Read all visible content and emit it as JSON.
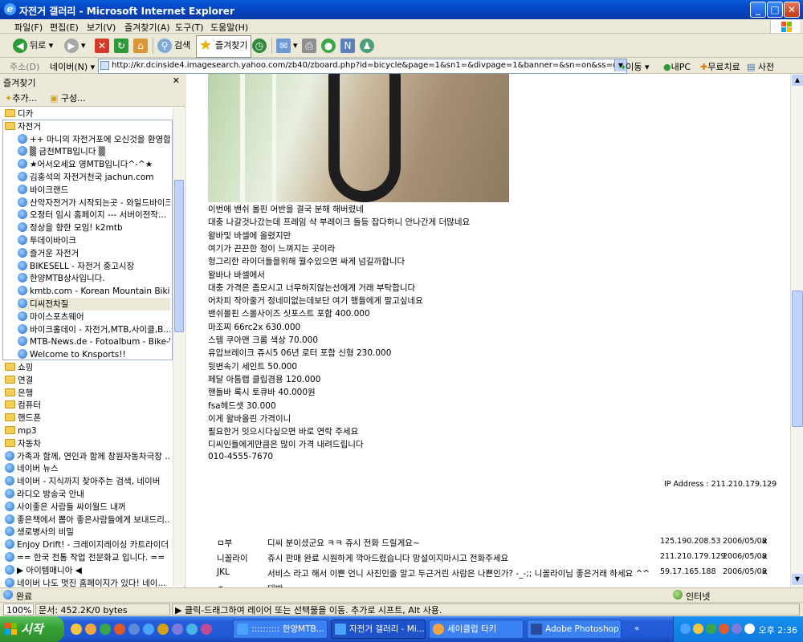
{
  "window": {
    "title": "자전거 갤러리 - Microsoft Internet Explorer",
    "minimize": "_",
    "maximize": "□",
    "close": "✕"
  },
  "menu": [
    "파일(F)",
    "편집(E)",
    "보기(V)",
    "즐겨찾기(A)",
    "도구(T)",
    "도움말(H)"
  ],
  "toolbar": {
    "back": "뒤로",
    "search": "검색",
    "favorites": "즐겨찾기"
  },
  "address": {
    "label": "주소(D)",
    "naver": "네이버(N)",
    "url": "http://kr.dcinside4.imagesearch.yahoo.com/zb40/zboard.php?id=bicycle&page=1&sn1=&divpage=1&banner=&sn=on&ss=off&sc=off&keyword",
    "go": "이동",
    "link1": "내PC",
    "link2": "무료치료",
    "link3": "사전"
  },
  "favorites": {
    "header": "즐겨찾기",
    "add": "추가...",
    "organize": "구성...",
    "items": [
      {
        "type": "folder",
        "label": "디카",
        "indent": 0
      },
      {
        "type": "folder",
        "label": "자전거",
        "indent": 0
      },
      {
        "type": "link",
        "label": "++ 마니의 자전거포에 오신것을 환영합...",
        "indent": 1
      },
      {
        "type": "link",
        "label": "▒ 금천MTB입니다 ▒",
        "indent": 1
      },
      {
        "type": "link",
        "label": "★어서오세요 영MTB입니다^-^★",
        "indent": 1
      },
      {
        "type": "link",
        "label": "김홍석의 자전거천국 jachun.com",
        "indent": 1
      },
      {
        "type": "link",
        "label": "바이크랜드",
        "indent": 1
      },
      {
        "type": "link",
        "label": "산악자전거가 시작되는곳 - 와일드바이크",
        "indent": 1
      },
      {
        "type": "link",
        "label": "오정터 임시 홈페이지 --- 서버이전작...",
        "indent": 1
      },
      {
        "type": "link",
        "label": "정상을 향한 모임! k2mtb",
        "indent": 1
      },
      {
        "type": "link",
        "label": "투데이바이크",
        "indent": 1
      },
      {
        "type": "link",
        "label": "즐거운 자전거",
        "indent": 1
      },
      {
        "type": "link",
        "label": "BIKESELL - 자전거 중고시장",
        "indent": 1
      },
      {
        "type": "link",
        "label": "한양MTB상사입니다.",
        "indent": 1
      },
      {
        "type": "link",
        "label": "kmtb.com - Korean Mountain Biking",
        "indent": 1
      },
      {
        "type": "link",
        "label": "디씨전차질",
        "indent": 1,
        "selected": true
      },
      {
        "type": "link",
        "label": "마이스포츠웨어",
        "indent": 1
      },
      {
        "type": "link",
        "label": "바이크홀데이 - 자전거,MTB,사이클,B...",
        "indent": 1
      },
      {
        "type": "link",
        "label": "MTB-News.de - Fotoalbum - Bike-W...",
        "indent": 1
      },
      {
        "type": "link",
        "label": "Welcome to Knsports!!",
        "indent": 1
      },
      {
        "type": "folder",
        "label": "쇼핑",
        "indent": 0
      },
      {
        "type": "folder",
        "label": "연결",
        "indent": 0
      },
      {
        "type": "folder",
        "label": "은행",
        "indent": 0
      },
      {
        "type": "folder",
        "label": "컴퓨터",
        "indent": 0
      },
      {
        "type": "folder",
        "label": "핸드폰",
        "indent": 0
      },
      {
        "type": "folder",
        "label": "mp3",
        "indent": 0
      },
      {
        "type": "folder",
        "label": "자동차",
        "indent": 0
      },
      {
        "type": "link",
        "label": "가족과 함께, 연인과 함께 창원자동차극장 ...",
        "indent": 0
      },
      {
        "type": "link",
        "label": "네이버  뉴스",
        "indent": 0
      },
      {
        "type": "link",
        "label": "네이버 - 지식까지 찾아주는 검색, 네이버",
        "indent": 0
      },
      {
        "type": "link",
        "label": "라디오 방송국 안내",
        "indent": 0
      },
      {
        "type": "link",
        "label": "사이좋은 사람들 싸이월드 내꺼",
        "indent": 0
      },
      {
        "type": "link",
        "label": "좋은책에서 뽑아 좋은사람들에게 보내드리...",
        "indent": 0
      },
      {
        "type": "link",
        "label": "생로병사의 비밀",
        "indent": 0
      },
      {
        "type": "link",
        "label": "Enjoy Drift! - 크레이지레이싱 카트라이더",
        "indent": 0
      },
      {
        "type": "link",
        "label": "== 한국 전통 작업 전문화교 입니다. ==",
        "indent": 0
      },
      {
        "type": "link",
        "label": "▶ 아이템매니아 ◀",
        "indent": 0
      },
      {
        "type": "link",
        "label": "네이버  나도 멋진 홈페이지가 있다! 네이...",
        "indent": 0
      }
    ]
  },
  "post": {
    "lines": [
      "이번에 밴쉬 몰핀 어반을 결국 분해 해버렸네",
      "대충 나갈것나갔는데 프레임 샥 부레이크 들등 잡다하니 안나간게 더많네요",
      "왈바및 바셀에 올렸지만",
      "여기가 끈끈한 정이 느껴지는 곳이라",
      "헝그리한 라이더들을위해 뭘수있으면 싸게 넘길까합니다",
      "왈바나 바셀에서",
      "대충 가격은 좀모시고 너무하지않는선에게 거래 부탁합니다",
      "어차피 작아줄거 정네미없는데보단 여기 행들에게 팔고싶네요",
      "밴쉬몰핀 스몰사이즈 싯포스트 포함 400.000",
      "마조찌 66rc2x 630.000",
      "스템 쿠아맨 크롬 색상 70.000",
      "유압브레이크 쥬시5 06년 로터 포함 신형 230.000",
      "뒷변속기 세인트 50.000",
      "페달 아톰랩 클립겸용 120.000",
      "핸들바 록시 토큐바 40.000원",
      "fsa헤드셋 30.000",
      "이게 왈바올린 가격이니",
      "필요한거 잇으시다싶으면 바로 연락 주세요",
      "디씨인들에게만큼은 많이 가격 내려드립니다",
      "010-4555-7670"
    ],
    "ip": "IP Address : 211.210.179.129"
  },
  "comments": [
    {
      "name": "ㅁ부",
      "text": "디씨 분이셨군요 ㅋㅋ 쥬시 전화 드릴게요~",
      "ip": "125.190.208.53",
      "date": "2006/05/08",
      "x": "×"
    },
    {
      "name": "니꼴라이",
      "text": "쥬시 판매 완료 시원하게 깍아드렸습니다 망설이지마시고 전화주세요",
      "ip": "211.210.179.129",
      "date": "2006/05/08",
      "x": "×"
    },
    {
      "name": "JKL",
      "text": "서비스 라고 해서 이쁜 언니 사진인줄 알고 두근거린 사람은 나쁜인가? -_-;; 니꼴라이님 좋은거래 하세요 ^^",
      "ip": "59.17.165.188",
      "date": "2006/05/08",
      "x": "×"
    },
    {
      "name": "ㅊ",
      "text": "대박",
      "ip": "",
      "date": "",
      "x": ""
    }
  ],
  "statusbar": {
    "done": "완료",
    "zone": "인터넷",
    "zoom": "100%",
    "doc": "문서: 452.2K/0 bytes",
    "hint": "클릭-드래그하여 레이어 또는 선택물을 이동. 추가로 시프트, Alt 사용."
  },
  "taskbar": {
    "start": "시작",
    "tasks": [
      {
        "label": ":::::::::: 한양MTB...",
        "active": false
      },
      {
        "label": "자전거 갤러리 - Mi...",
        "active": true
      },
      {
        "label": "세이클럽 타키",
        "active": false
      },
      {
        "label": "Adobe Photoshop ...",
        "active": false
      }
    ],
    "clock": "오후 2:36"
  },
  "colors": {
    "xp_blue": "#0a5bd6",
    "start_green": "#36a336",
    "tray_blue": "#1690ee"
  }
}
